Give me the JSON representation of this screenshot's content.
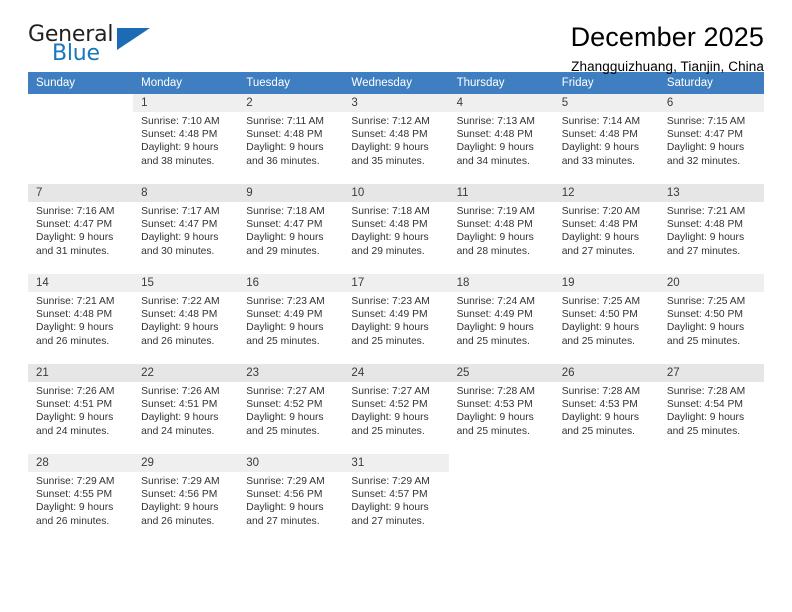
{
  "brand": {
    "word_general": "General",
    "word_blue": "Blue",
    "triangle_color": "#1b6cb5"
  },
  "header": {
    "title": "December 2025",
    "subtitle": "Zhangguizhuang, Tianjin, China"
  },
  "theme": {
    "header_row_bg": "#3f7fc1",
    "header_row_text": "#ffffff",
    "daynum_bg": "#efefef",
    "daynum_bg_alt": "#e6e6e6",
    "body_text": "#333333"
  },
  "weekdays": [
    "Sunday",
    "Monday",
    "Tuesday",
    "Wednesday",
    "Thursday",
    "Friday",
    "Saturday"
  ],
  "weeks": [
    [
      {
        "day": "",
        "sunrise": "",
        "sunset": "",
        "daylight_line1": "",
        "daylight_line2": ""
      },
      {
        "day": "1",
        "sunrise": "Sunrise: 7:10 AM",
        "sunset": "Sunset: 4:48 PM",
        "daylight_line1": "Daylight: 9 hours",
        "daylight_line2": "and 38 minutes."
      },
      {
        "day": "2",
        "sunrise": "Sunrise: 7:11 AM",
        "sunset": "Sunset: 4:48 PM",
        "daylight_line1": "Daylight: 9 hours",
        "daylight_line2": "and 36 minutes."
      },
      {
        "day": "3",
        "sunrise": "Sunrise: 7:12 AM",
        "sunset": "Sunset: 4:48 PM",
        "daylight_line1": "Daylight: 9 hours",
        "daylight_line2": "and 35 minutes."
      },
      {
        "day": "4",
        "sunrise": "Sunrise: 7:13 AM",
        "sunset": "Sunset: 4:48 PM",
        "daylight_line1": "Daylight: 9 hours",
        "daylight_line2": "and 34 minutes."
      },
      {
        "day": "5",
        "sunrise": "Sunrise: 7:14 AM",
        "sunset": "Sunset: 4:48 PM",
        "daylight_line1": "Daylight: 9 hours",
        "daylight_line2": "and 33 minutes."
      },
      {
        "day": "6",
        "sunrise": "Sunrise: 7:15 AM",
        "sunset": "Sunset: 4:47 PM",
        "daylight_line1": "Daylight: 9 hours",
        "daylight_line2": "and 32 minutes."
      }
    ],
    [
      {
        "day": "7",
        "sunrise": "Sunrise: 7:16 AM",
        "sunset": "Sunset: 4:47 PM",
        "daylight_line1": "Daylight: 9 hours",
        "daylight_line2": "and 31 minutes."
      },
      {
        "day": "8",
        "sunrise": "Sunrise: 7:17 AM",
        "sunset": "Sunset: 4:47 PM",
        "daylight_line1": "Daylight: 9 hours",
        "daylight_line2": "and 30 minutes."
      },
      {
        "day": "9",
        "sunrise": "Sunrise: 7:18 AM",
        "sunset": "Sunset: 4:47 PM",
        "daylight_line1": "Daylight: 9 hours",
        "daylight_line2": "and 29 minutes."
      },
      {
        "day": "10",
        "sunrise": "Sunrise: 7:18 AM",
        "sunset": "Sunset: 4:48 PM",
        "daylight_line1": "Daylight: 9 hours",
        "daylight_line2": "and 29 minutes."
      },
      {
        "day": "11",
        "sunrise": "Sunrise: 7:19 AM",
        "sunset": "Sunset: 4:48 PM",
        "daylight_line1": "Daylight: 9 hours",
        "daylight_line2": "and 28 minutes."
      },
      {
        "day": "12",
        "sunrise": "Sunrise: 7:20 AM",
        "sunset": "Sunset: 4:48 PM",
        "daylight_line1": "Daylight: 9 hours",
        "daylight_line2": "and 27 minutes."
      },
      {
        "day": "13",
        "sunrise": "Sunrise: 7:21 AM",
        "sunset": "Sunset: 4:48 PM",
        "daylight_line1": "Daylight: 9 hours",
        "daylight_line2": "and 27 minutes."
      }
    ],
    [
      {
        "day": "14",
        "sunrise": "Sunrise: 7:21 AM",
        "sunset": "Sunset: 4:48 PM",
        "daylight_line1": "Daylight: 9 hours",
        "daylight_line2": "and 26 minutes."
      },
      {
        "day": "15",
        "sunrise": "Sunrise: 7:22 AM",
        "sunset": "Sunset: 4:48 PM",
        "daylight_line1": "Daylight: 9 hours",
        "daylight_line2": "and 26 minutes."
      },
      {
        "day": "16",
        "sunrise": "Sunrise: 7:23 AM",
        "sunset": "Sunset: 4:49 PM",
        "daylight_line1": "Daylight: 9 hours",
        "daylight_line2": "and 25 minutes."
      },
      {
        "day": "17",
        "sunrise": "Sunrise: 7:23 AM",
        "sunset": "Sunset: 4:49 PM",
        "daylight_line1": "Daylight: 9 hours",
        "daylight_line2": "and 25 minutes."
      },
      {
        "day": "18",
        "sunrise": "Sunrise: 7:24 AM",
        "sunset": "Sunset: 4:49 PM",
        "daylight_line1": "Daylight: 9 hours",
        "daylight_line2": "and 25 minutes."
      },
      {
        "day": "19",
        "sunrise": "Sunrise: 7:25 AM",
        "sunset": "Sunset: 4:50 PM",
        "daylight_line1": "Daylight: 9 hours",
        "daylight_line2": "and 25 minutes."
      },
      {
        "day": "20",
        "sunrise": "Sunrise: 7:25 AM",
        "sunset": "Sunset: 4:50 PM",
        "daylight_line1": "Daylight: 9 hours",
        "daylight_line2": "and 25 minutes."
      }
    ],
    [
      {
        "day": "21",
        "sunrise": "Sunrise: 7:26 AM",
        "sunset": "Sunset: 4:51 PM",
        "daylight_line1": "Daylight: 9 hours",
        "daylight_line2": "and 24 minutes."
      },
      {
        "day": "22",
        "sunrise": "Sunrise: 7:26 AM",
        "sunset": "Sunset: 4:51 PM",
        "daylight_line1": "Daylight: 9 hours",
        "daylight_line2": "and 24 minutes."
      },
      {
        "day": "23",
        "sunrise": "Sunrise: 7:27 AM",
        "sunset": "Sunset: 4:52 PM",
        "daylight_line1": "Daylight: 9 hours",
        "daylight_line2": "and 25 minutes."
      },
      {
        "day": "24",
        "sunrise": "Sunrise: 7:27 AM",
        "sunset": "Sunset: 4:52 PM",
        "daylight_line1": "Daylight: 9 hours",
        "daylight_line2": "and 25 minutes."
      },
      {
        "day": "25",
        "sunrise": "Sunrise: 7:28 AM",
        "sunset": "Sunset: 4:53 PM",
        "daylight_line1": "Daylight: 9 hours",
        "daylight_line2": "and 25 minutes."
      },
      {
        "day": "26",
        "sunrise": "Sunrise: 7:28 AM",
        "sunset": "Sunset: 4:53 PM",
        "daylight_line1": "Daylight: 9 hours",
        "daylight_line2": "and 25 minutes."
      },
      {
        "day": "27",
        "sunrise": "Sunrise: 7:28 AM",
        "sunset": "Sunset: 4:54 PM",
        "daylight_line1": "Daylight: 9 hours",
        "daylight_line2": "and 25 minutes."
      }
    ],
    [
      {
        "day": "28",
        "sunrise": "Sunrise: 7:29 AM",
        "sunset": "Sunset: 4:55 PM",
        "daylight_line1": "Daylight: 9 hours",
        "daylight_line2": "and 26 minutes."
      },
      {
        "day": "29",
        "sunrise": "Sunrise: 7:29 AM",
        "sunset": "Sunset: 4:56 PM",
        "daylight_line1": "Daylight: 9 hours",
        "daylight_line2": "and 26 minutes."
      },
      {
        "day": "30",
        "sunrise": "Sunrise: 7:29 AM",
        "sunset": "Sunset: 4:56 PM",
        "daylight_line1": "Daylight: 9 hours",
        "daylight_line2": "and 27 minutes."
      },
      {
        "day": "31",
        "sunrise": "Sunrise: 7:29 AM",
        "sunset": "Sunset: 4:57 PM",
        "daylight_line1": "Daylight: 9 hours",
        "daylight_line2": "and 27 minutes."
      },
      {
        "day": "",
        "sunrise": "",
        "sunset": "",
        "daylight_line1": "",
        "daylight_line2": ""
      },
      {
        "day": "",
        "sunrise": "",
        "sunset": "",
        "daylight_line1": "",
        "daylight_line2": ""
      },
      {
        "day": "",
        "sunrise": "",
        "sunset": "",
        "daylight_line1": "",
        "daylight_line2": ""
      }
    ]
  ]
}
